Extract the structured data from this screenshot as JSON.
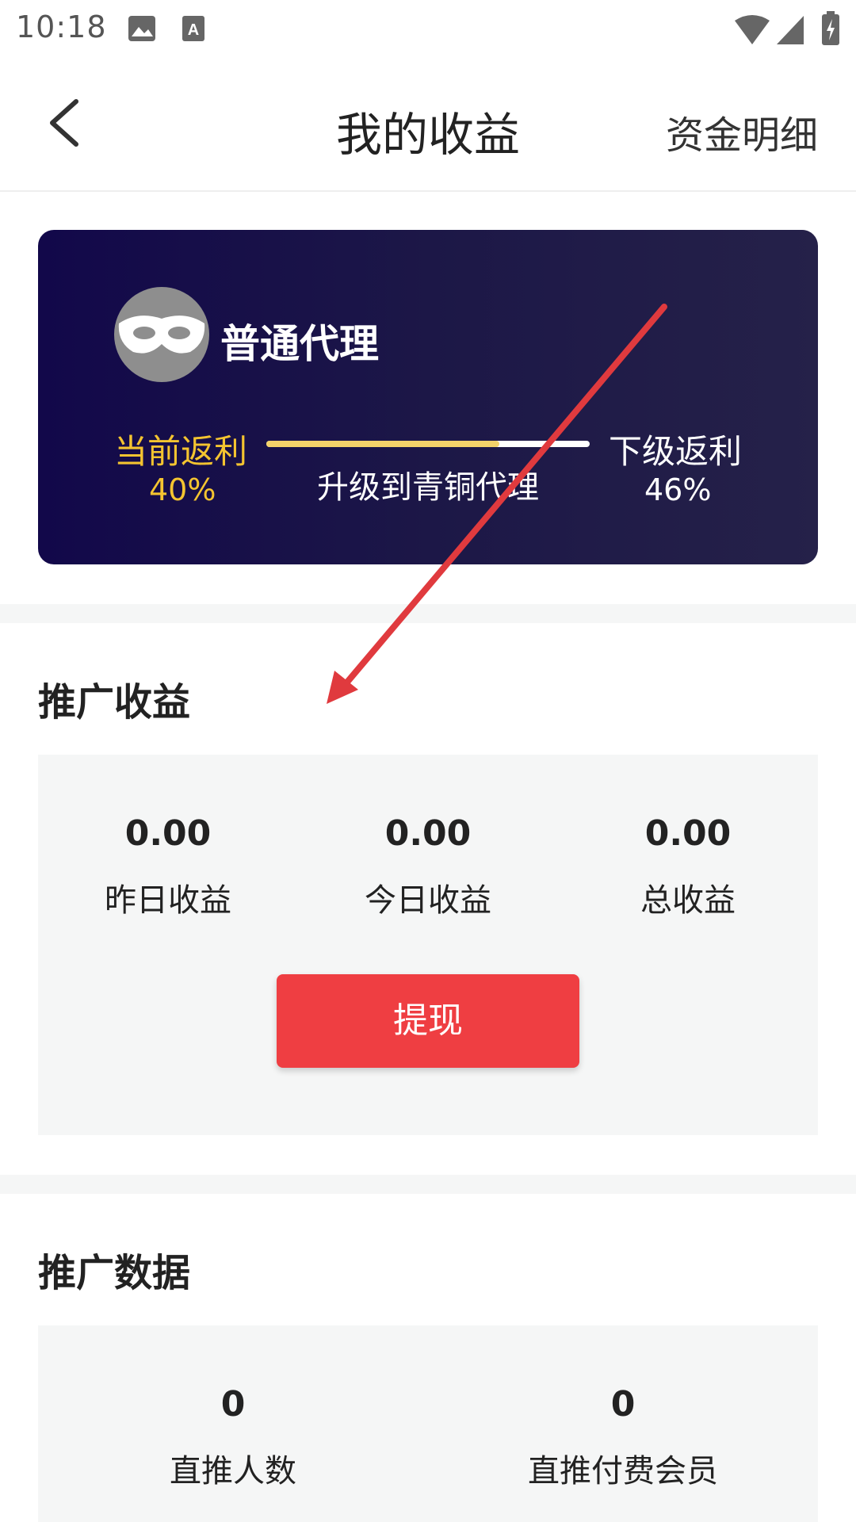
{
  "status_bar": {
    "time": "10:18",
    "icons": [
      "image-icon",
      "font-icon",
      "wifi-icon",
      "signal-icon",
      "battery-icon"
    ]
  },
  "header": {
    "back_icon": "chevron-left-icon",
    "title": "我的收益",
    "detail_link": "资金明细"
  },
  "agent_card": {
    "level_name": "普通代理",
    "current_rebate_label": "当前返利",
    "current_rebate_value": "40%",
    "upgrade_text": "升级到青铜代理",
    "next_rebate_label": "下级返利",
    "next_rebate_value": "46%",
    "progress_fraction": 0.72,
    "accent_color": "#f4c430"
  },
  "promo_earnings": {
    "title": "推广收益",
    "stats": [
      {
        "value": "0.00",
        "label": "昨日收益"
      },
      {
        "value": "0.00",
        "label": "今日收益"
      },
      {
        "value": "0.00",
        "label": "总收益"
      }
    ],
    "withdraw_label": "提现",
    "button_color": "#ef3e42"
  },
  "promo_data": {
    "title": "推广数据",
    "stats": [
      {
        "value": "0",
        "label": "直推人数"
      },
      {
        "value": "0",
        "label": "直推付费会员"
      }
    ]
  }
}
